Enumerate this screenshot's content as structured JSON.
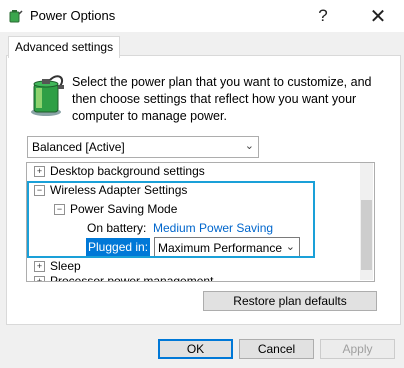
{
  "window": {
    "title": "Power Options",
    "help_label": "?",
    "close_label": "✕"
  },
  "tabs": [
    {
      "label": "Advanced settings"
    }
  ],
  "description": "Select the power plan that you want to customize, and then choose settings that reflect how you want your computer to manage power.",
  "plan_select": {
    "value": "Balanced [Active]"
  },
  "tree": {
    "items": [
      {
        "label": "Desktop background settings",
        "expander": "+"
      },
      {
        "label": "Wireless Adapter Settings",
        "expander": "−"
      },
      {
        "label": "Power Saving Mode",
        "expander": "−"
      },
      {
        "label": "On battery:",
        "value": "Medium Power Saving"
      },
      {
        "label": "Plugged in:",
        "value": "Maximum Performance"
      },
      {
        "label": "Sleep",
        "expander": "+"
      },
      {
        "label": "Processor power management",
        "expander": "+"
      }
    ]
  },
  "buttons": {
    "restore": "Restore plan defaults",
    "ok": "OK",
    "cancel": "Cancel",
    "apply": "Apply"
  },
  "colors": {
    "accent": "#0078d7",
    "link": "#0066cc",
    "highlight_box": "#1aa0d8"
  }
}
